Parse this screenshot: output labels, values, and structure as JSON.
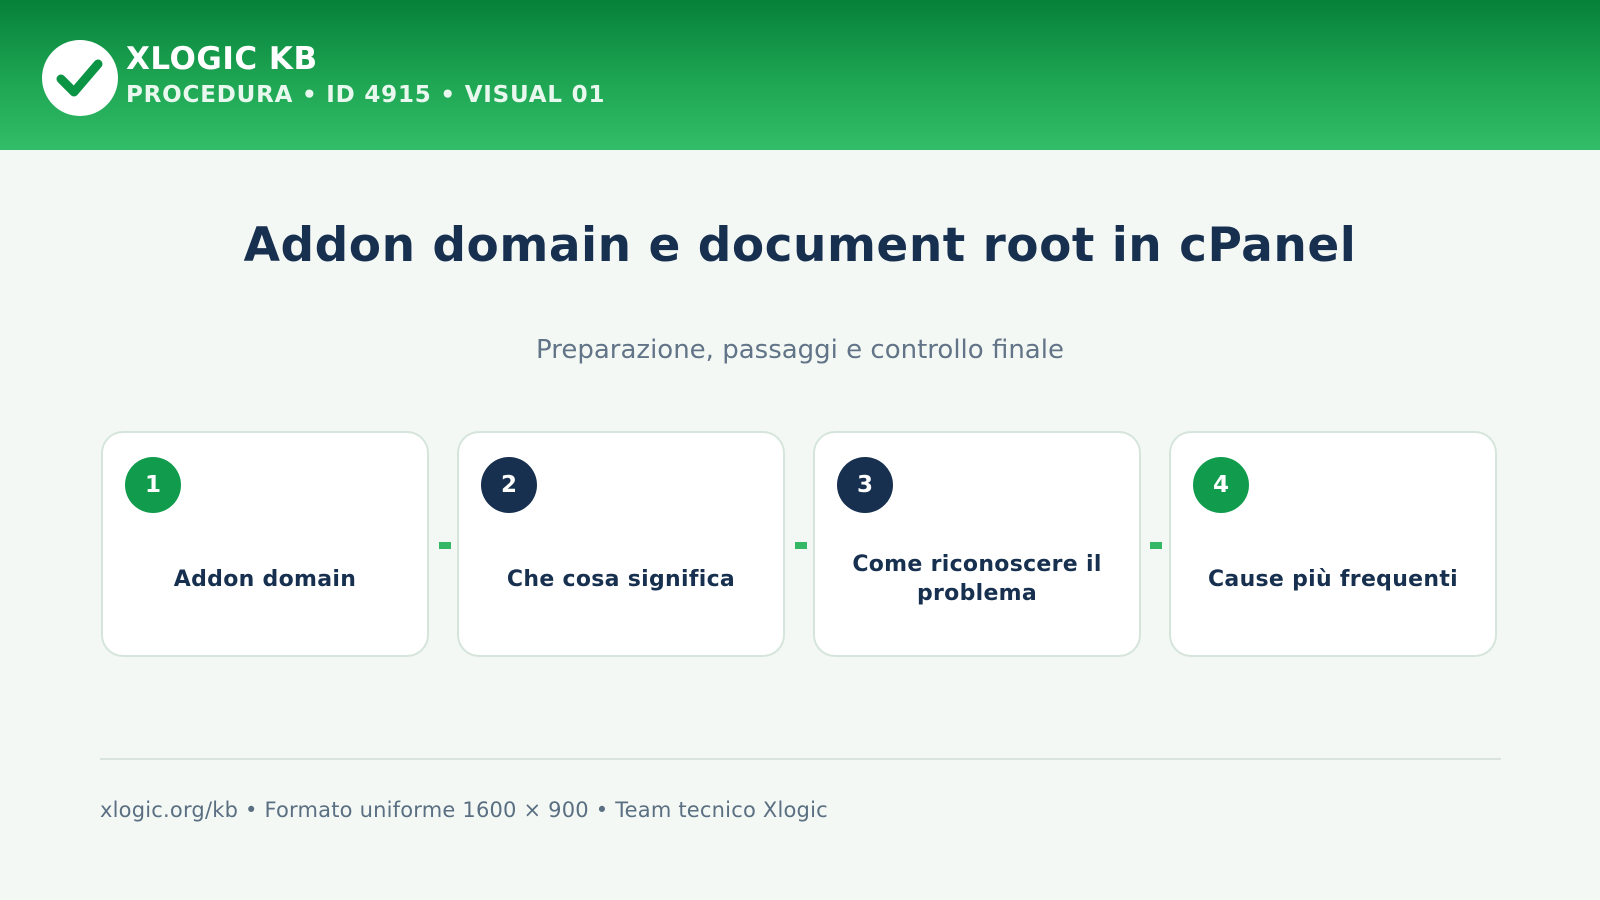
{
  "header": {
    "brand_name": "XLOGIC KB",
    "brand_subtitle": "PROCEDURA • ID 4915 • VISUAL 01",
    "logo_icon": "checkmark-icon",
    "gradient_colors": [
      "#068139",
      "#32bd68"
    ]
  },
  "main": {
    "title": "Addon domain e document root in cPanel",
    "subtitle": "Preparazione, passaggi e controllo finale",
    "steps": [
      {
        "number": "1",
        "label": "Addon domain",
        "badge_color": "#109c4c"
      },
      {
        "number": "2",
        "label": "Che cosa significa",
        "badge_color": "#17304f"
      },
      {
        "number": "3",
        "label": "Come riconoscere il problema",
        "badge_color": "#17304f"
      },
      {
        "number": "4",
        "label": "Cause più frequenti",
        "badge_color": "#109c4c"
      }
    ]
  },
  "footer": {
    "text": "xlogic.org/kb • Formato uniforme 1600 × 900 • Team tecnico Xlogic"
  },
  "colors": {
    "accent_green": "#109c4c",
    "navy": "#17304f",
    "background": "#f4f8f5"
  }
}
